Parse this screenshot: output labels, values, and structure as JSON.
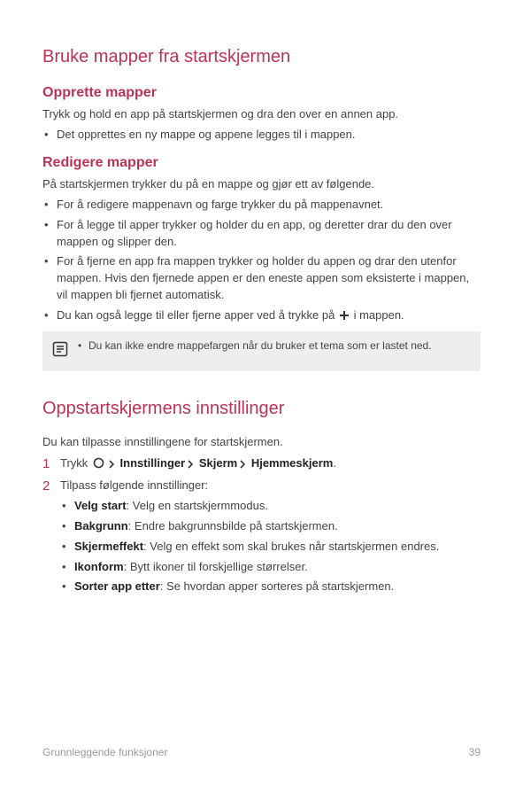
{
  "section1": {
    "title": "Bruke mapper fra startskjermen",
    "sub1": {
      "title": "Opprette mapper",
      "intro": "Trykk og hold en app på startskjermen og dra den over en annen app.",
      "items": [
        "Det opprettes en ny mappe og appene legges til i mappen."
      ]
    },
    "sub2": {
      "title": "Redigere mapper",
      "intro": "På startskjermen trykker du på en mappe og gjør ett av følgende.",
      "items": [
        "For å redigere mappenavn og farge trykker du på mappenavnet.",
        "For å legge til apper trykker og holder du en app, og deretter drar du den over mappen og slipper den.",
        "For å fjerne en app fra mappen trykker og holder du appen og drar den utenfor mappen. Hvis den fjernede appen er den eneste appen som eksisterte i mappen, vil mappen bli fjernet automatisk.",
        "Du kan også legge til eller fjerne apper ved å trykke på "
      ],
      "item4_tail": " i mappen.",
      "note": "Du kan ikke endre mappefargen når du bruker et tema som er lastet ned."
    }
  },
  "section2": {
    "title": "Oppstartskjermens innstillinger",
    "intro": "Du kan tilpasse innstillingene for startskjermen.",
    "step1": {
      "prefix": "Trykk ",
      "path": [
        "Innstillinger",
        "Skjerm",
        "Hjemmeskjerm"
      ],
      "suffix": "."
    },
    "step2": {
      "text": "Tilpass følgende innstillinger:",
      "options": [
        {
          "label": "Velg start",
          "desc": ": Velg en startskjermmodus."
        },
        {
          "label": "Bakgrunn",
          "desc": ": Endre bakgrunnsbilde på startskjermen."
        },
        {
          "label": "Skjermeffekt",
          "desc": ": Velg en effekt som skal brukes når startskjermen endres."
        },
        {
          "label": "Ikonform",
          "desc": ": Bytt ikoner til forskjellige størrelser."
        },
        {
          "label": "Sorter app etter",
          "desc": ": Se hvordan apper sorteres på startskjermen."
        }
      ]
    }
  },
  "footer": {
    "left": "Grunnleggende funksjoner",
    "right": "39"
  }
}
